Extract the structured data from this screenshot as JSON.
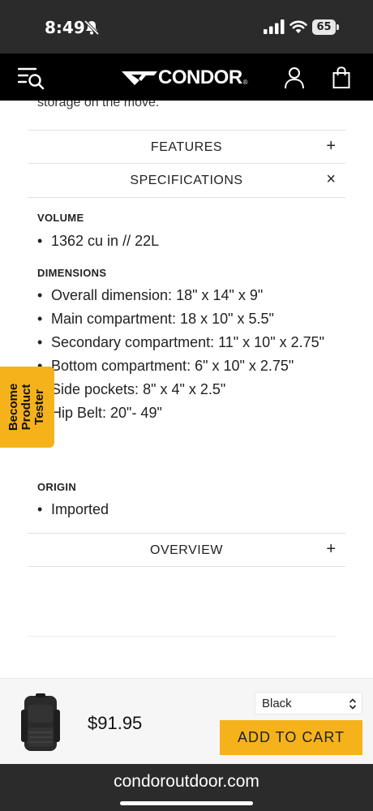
{
  "status_bar": {
    "time": "8:49",
    "battery": "65",
    "icons": [
      "bell-muted-icon",
      "cellular-signal-icon",
      "wifi-icon",
      "battery-icon"
    ]
  },
  "nav": {
    "brand": "CONDOR",
    "brand_mark": "®",
    "icons": [
      "menu-search-icon",
      "condor-logo-icon",
      "account-icon",
      "shopping-bag-icon"
    ]
  },
  "content": {
    "cut_text": "storage on the move.",
    "accordions": {
      "features": {
        "label": "FEATURES",
        "toggle": "+"
      },
      "specifications": {
        "label": "SPECIFICATIONS",
        "toggle": "×"
      },
      "overview": {
        "label": "OVERVIEW",
        "toggle": "+"
      }
    },
    "specifications": {
      "volume": {
        "heading": "VOLUME",
        "items": [
          "1362 cu in // 22L"
        ]
      },
      "dimensions": {
        "heading": "DIMENSIONS",
        "items": [
          "Overall dimension: 18\" x 14\" x 9\"",
          "Main compartment: 18 x 10\" x 5.5\"",
          "Secondary compartment: 11\" x 10\" x 2.75\"",
          "Bottom compartment: 6\" x 10\" x 2.75\"",
          "Side pockets: 8\" x 4\" x 2.5\"",
          "Hip Belt: 20\"- 49\""
        ]
      },
      "origin": {
        "heading": "ORIGIN",
        "items": [
          "Imported"
        ]
      }
    }
  },
  "tester_tab": {
    "lines": [
      "Become",
      "Product",
      "Tester"
    ]
  },
  "buy_bar": {
    "price": "$91.95",
    "variant": "Black",
    "add_to_cart": "ADD TO CART",
    "thumbnail": "black-backpack"
  },
  "url_bar": {
    "url": "condoroutdoor.com"
  },
  "colors": {
    "accent": "#f5b21b",
    "header_bg": "#000000",
    "system_bar_bg": "#2b2b2b"
  }
}
